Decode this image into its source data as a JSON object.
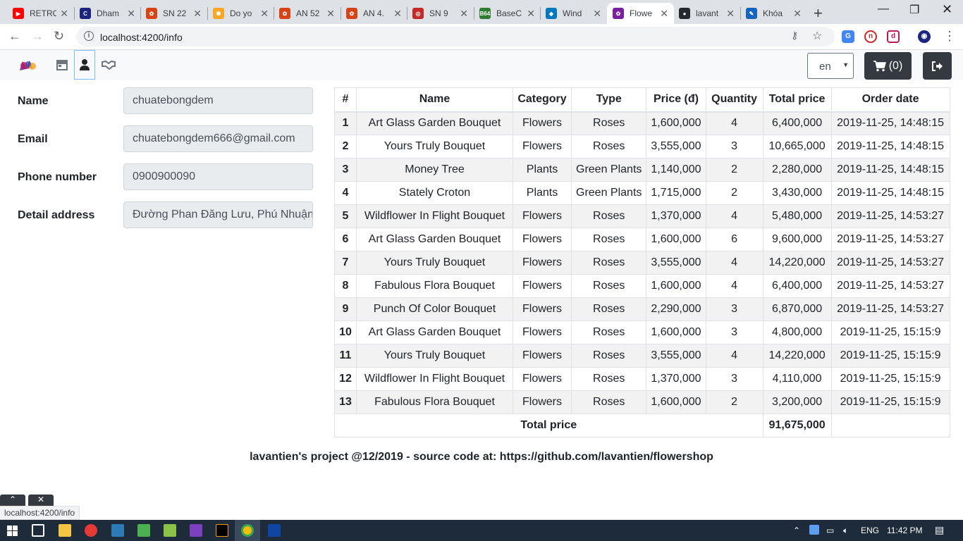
{
  "browser": {
    "tabs": [
      {
        "title": "RETRO",
        "fav_color": "#ff0000",
        "fav_glyph": "▶"
      },
      {
        "title": "Dham",
        "fav_color": "#1a237e",
        "fav_glyph": "C"
      },
      {
        "title": "SN 22",
        "fav_color": "#d84315",
        "fav_glyph": "✿"
      },
      {
        "title": "Do yo",
        "fav_color": "#f9a825",
        "fav_glyph": "✺"
      },
      {
        "title": "AN 52",
        "fav_color": "#d84315",
        "fav_glyph": "✿"
      },
      {
        "title": "AN 4.",
        "fav_color": "#d84315",
        "fav_glyph": "✿"
      },
      {
        "title": "SN 9",
        "fav_color": "#c62828",
        "fav_glyph": "◎"
      },
      {
        "title": "BaseC",
        "fav_color": "#2e7d32",
        "fav_glyph": "B64"
      },
      {
        "title": "Wind",
        "fav_color": "#0277bd",
        "fav_glyph": "◆"
      },
      {
        "title": "Flowe",
        "fav_color": "#7b1fa2",
        "fav_glyph": "✿",
        "active": true
      },
      {
        "title": "lavant",
        "fav_color": "#24292e",
        "fav_glyph": "●"
      },
      {
        "title": "Khóa",
        "fav_color": "#1565c0",
        "fav_glyph": "✎"
      }
    ],
    "url": "localhost:4200/info",
    "status_url": "localhost:4200/info"
  },
  "navbar": {
    "language": "en",
    "cart_label": "(0)"
  },
  "profile": {
    "fields": [
      {
        "label": "Name",
        "value": "chuatebongdem"
      },
      {
        "label": "Email",
        "value": "chuatebongdem666@gmail.com"
      },
      {
        "label": "Phone number",
        "value": "0900900090"
      },
      {
        "label": "Detail address",
        "value": "Đường Phan Đăng Lưu, Phú Nhuận"
      }
    ]
  },
  "orders": {
    "headers": [
      "#",
      "Name",
      "Category",
      "Type",
      "Price (đ)",
      "Quantity",
      "Total price",
      "Order date"
    ],
    "rows": [
      [
        "1",
        "Art Glass Garden Bouquet",
        "Flowers",
        "Roses",
        "1,600,000",
        "4",
        "6,400,000",
        "2019-11-25, 14:48:15"
      ],
      [
        "2",
        "Yours Truly Bouquet",
        "Flowers",
        "Roses",
        "3,555,000",
        "3",
        "10,665,000",
        "2019-11-25, 14:48:15"
      ],
      [
        "3",
        "Money Tree",
        "Plants",
        "Green Plants",
        "1,140,000",
        "2",
        "2,280,000",
        "2019-11-25, 14:48:15"
      ],
      [
        "4",
        "Stately Croton",
        "Plants",
        "Green Plants",
        "1,715,000",
        "2",
        "3,430,000",
        "2019-11-25, 14:48:15"
      ],
      [
        "5",
        "Wildflower In Flight Bouquet",
        "Flowers",
        "Roses",
        "1,370,000",
        "4",
        "5,480,000",
        "2019-11-25, 14:53:27"
      ],
      [
        "6",
        "Art Glass Garden Bouquet",
        "Flowers",
        "Roses",
        "1,600,000",
        "6",
        "9,600,000",
        "2019-11-25, 14:53:27"
      ],
      [
        "7",
        "Yours Truly Bouquet",
        "Flowers",
        "Roses",
        "3,555,000",
        "4",
        "14,220,000",
        "2019-11-25, 14:53:27"
      ],
      [
        "8",
        "Fabulous Flora Bouquet",
        "Flowers",
        "Roses",
        "1,600,000",
        "4",
        "6,400,000",
        "2019-11-25, 14:53:27"
      ],
      [
        "9",
        "Punch Of Color Bouquet",
        "Flowers",
        "Roses",
        "2,290,000",
        "3",
        "6,870,000",
        "2019-11-25, 14:53:27"
      ],
      [
        "10",
        "Art Glass Garden Bouquet",
        "Flowers",
        "Roses",
        "1,600,000",
        "3",
        "4,800,000",
        "2019-11-25, 15:15:9"
      ],
      [
        "11",
        "Yours Truly Bouquet",
        "Flowers",
        "Roses",
        "3,555,000",
        "4",
        "14,220,000",
        "2019-11-25, 15:15:9"
      ],
      [
        "12",
        "Wildflower In Flight Bouquet",
        "Flowers",
        "Roses",
        "1,370,000",
        "3",
        "4,110,000",
        "2019-11-25, 15:15:9"
      ],
      [
        "13",
        "Fabulous Flora Bouquet",
        "Flowers",
        "Roses",
        "1,600,000",
        "2",
        "3,200,000",
        "2019-11-25, 15:15:9"
      ]
    ],
    "total_label": "Total price",
    "total_value": "91,675,000"
  },
  "footer": {
    "text": "lavantien's project @12/2019 - source code at: https://github.com/lavantien/flowershop"
  },
  "taskbar": {
    "language": "ENG",
    "time": "11:42 PM"
  }
}
